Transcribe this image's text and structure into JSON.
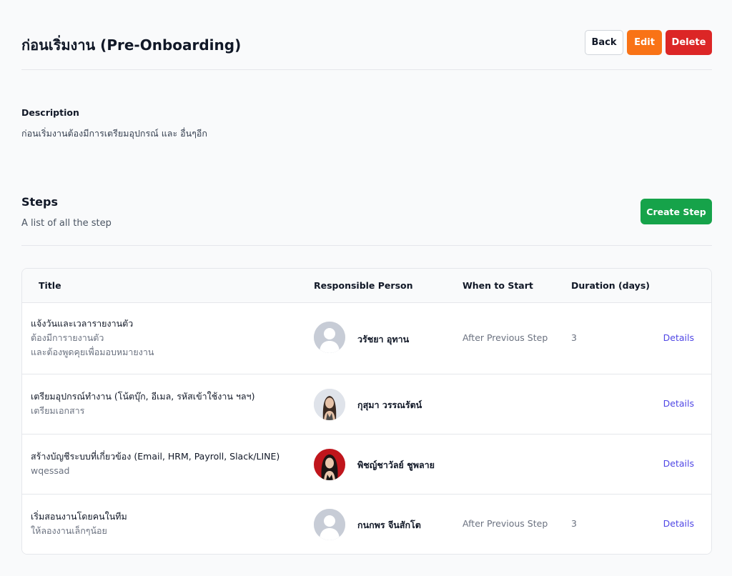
{
  "header": {
    "title": "ก่อนเริ่มงาน (Pre-Onboarding)",
    "back_label": "Back",
    "edit_label": "Edit",
    "delete_label": "Delete"
  },
  "description": {
    "label": "Description",
    "text": "ก่อนเริ่มงานต้องมีการเตรียมอุปกรณ์ และ อื่นๆอีก"
  },
  "steps": {
    "title": "Steps",
    "subtitle": "A list of all the step",
    "create_label": "Create Step",
    "columns": [
      "Title",
      "Responsible Person",
      "When to Start",
      "Duration (days)"
    ],
    "rows": [
      {
        "title": "แจ้งวันและเวลารายงานตัว",
        "description": "ต้องมีการายงานตัว\nและต้องพูดคุยเพื่อมอบหมายงาน",
        "person": "วรัชยา อุทาน",
        "avatar": "placeholder-avatar-icon",
        "when": "After Previous Step",
        "duration": "3",
        "action": "Details"
      },
      {
        "title": "เตรียมอุปกรณ์ทำงาน (โน้ตบุ๊ก, อีเมล, รหัสเข้าใช้งาน ฯลฯ)",
        "description": "เตรียมเอกสาร",
        "person": "กุสุมา วรรณรัตน์",
        "avatar": "user-photo-icon",
        "when": "",
        "duration": "",
        "action": "Details"
      },
      {
        "title": "สร้างบัญชีระบบที่เกี่ยวข้อง (Email, HRM, Payroll, Slack/LINE)",
        "description": "wqessad",
        "person": "พิชญ์ชาวัลย์ ชูพลาย",
        "avatar": "user-photo-icon",
        "when": "",
        "duration": "",
        "action": "Details"
      },
      {
        "title": "เริ่มสอนงานโดยคนในทีม",
        "description": "ให้ลองงานเล็กๆน้อย",
        "person": "กนกพร จีนสักโต",
        "avatar": "placeholder-avatar-icon",
        "when": "After Previous Step",
        "duration": "3",
        "action": "Details"
      }
    ]
  },
  "colors": {
    "edit": "#f97316",
    "delete": "#dc2626",
    "create": "#16a34a",
    "link": "#4f46e5"
  }
}
